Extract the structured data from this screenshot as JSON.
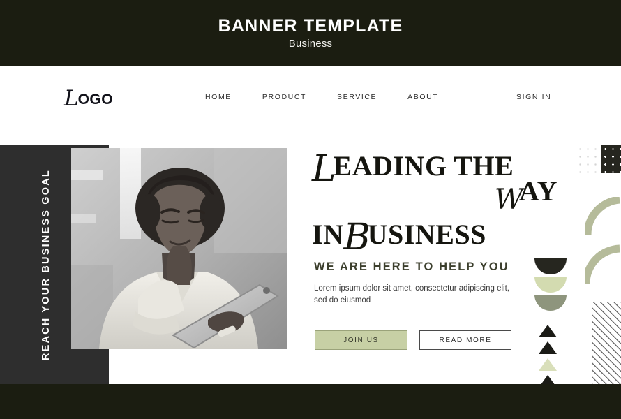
{
  "banner": {
    "title": "BANNER TEMPLATE",
    "subtitle": "Business"
  },
  "nav": {
    "logo_script": "L",
    "logo_rest": "OGO",
    "items": [
      {
        "label": "HOME"
      },
      {
        "label": "PRODUCT"
      },
      {
        "label": "SERVICE"
      },
      {
        "label": "ABOUT"
      }
    ],
    "signin": "SIGN IN"
  },
  "side_panel": {
    "vertical_text": "REACH YOUR BUSINESS GOAL"
  },
  "hero": {
    "photo_alt": "woman-with-tablet-photo",
    "headline": {
      "line1_script": "L",
      "line1_rest": "EADING THE",
      "line2_script": "W",
      "line2_rest": "AY",
      "line3_prefix": "IN",
      "line3_script": "B",
      "line3_rest": "USINESS"
    },
    "subheading": "WE ARE HERE TO HELP YOU",
    "body": "Lorem ipsum dolor sit amet, consectetur adipiscing elit, sed do eiusmod",
    "buttons": {
      "primary": "JOIN US",
      "secondary": "READ MORE"
    }
  },
  "decor": {
    "halfmoon_colors": [
      "#26261f",
      "#d3dbb0",
      "#8e957d"
    ],
    "triangle_colors": [
      "#1b1b16",
      "#1b1b16",
      "#d9dfba",
      "#1b1b16"
    ],
    "arc_color": "#b5bb9a",
    "dot_dark_bg": "#26261f",
    "stripe_color": "#6d6d6d"
  },
  "colors": {
    "dark_olive": "#1b1d11",
    "panel_gray": "#2e2e2e",
    "sage": "#c7d0a5",
    "text_dark": "#15150f"
  }
}
